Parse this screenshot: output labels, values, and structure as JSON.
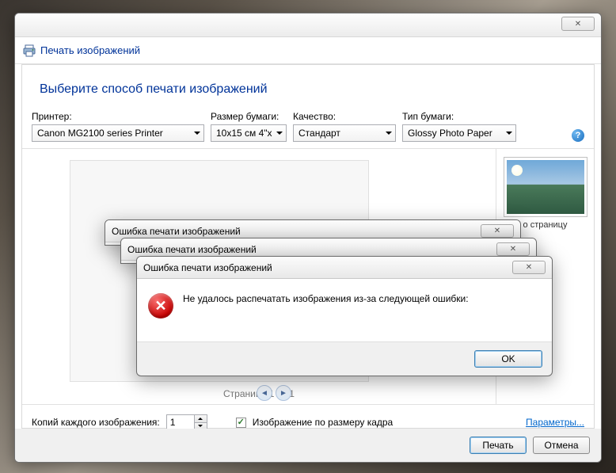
{
  "window": {
    "title": "Печать изображений"
  },
  "wizard": {
    "heading": "Выберите способ печати изображений"
  },
  "options": {
    "printer_label": "Принтер:",
    "printer_value": "Canon MG2100 series Printer",
    "paper_size_label": "Размер бумаги:",
    "paper_size_value": "10x15 см 4\"x",
    "quality_label": "Качество:",
    "quality_value": "Стандарт",
    "paper_type_label": "Тип бумаги:",
    "paper_type_value": "Glossy Photo Paper"
  },
  "sidebar": {
    "thumb_label": "о страницу"
  },
  "preview": {
    "page_indicator": "Страница 1 из 1"
  },
  "bottom": {
    "copies_label": "Копий каждого изображения:",
    "copies_value": "1",
    "fit_label": "Изображение по размеру кадра",
    "fit_checked": true,
    "params_link": "Параметры..."
  },
  "footer": {
    "print": "Печать",
    "cancel": "Отмена"
  },
  "error": {
    "title": "Ошибка печати изображений",
    "message": "Не удалось распечатать изображения из-за следующей ошибки:",
    "ok": "OK"
  }
}
